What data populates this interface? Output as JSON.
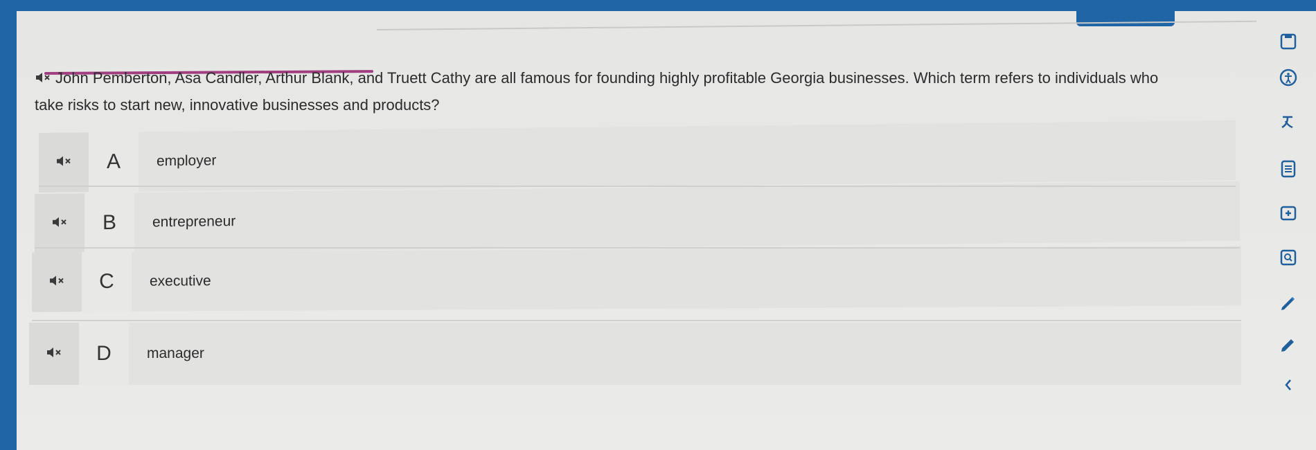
{
  "question": {
    "text": "John Pemberton, Asa Candler, Arthur Blank, and Truett Cathy are all famous for founding highly profitable Georgia businesses. Which term refers to individuals who take risks to start new, innovative businesses and products?"
  },
  "options": [
    {
      "letter": "A",
      "label": "employer"
    },
    {
      "letter": "B",
      "label": "entrepreneur"
    },
    {
      "letter": "C",
      "label": "executive"
    },
    {
      "letter": "D",
      "label": "manager"
    }
  ],
  "icons": {
    "audio": "speaker-mute-icon",
    "toolbar": [
      "bookmark-icon",
      "accessibility-icon",
      "translate-icon",
      "notes-icon",
      "zoom-in-icon",
      "magnifier-icon",
      "highlighter-icon",
      "eraser-icon",
      "collapse-icon"
    ]
  },
  "colors": {
    "frame": "#1f65a6",
    "progress": "#a13e80",
    "tool_icon": "#1e5f9c"
  }
}
